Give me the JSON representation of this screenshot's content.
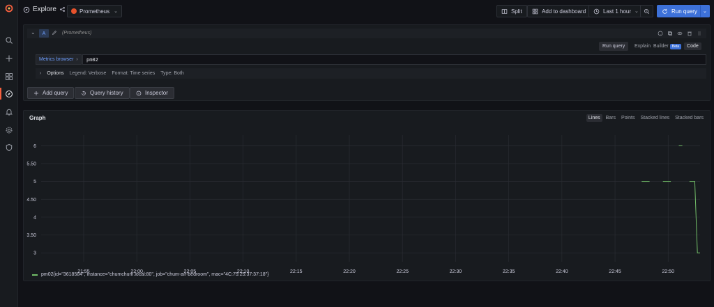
{
  "topbar": {
    "title": "Explore",
    "datasource": "Prometheus",
    "split_label": "Split",
    "add_to_dashboard_label": "Add to dashboard",
    "time_range_label": "Last 1 hour",
    "run_query_label": "Run query"
  },
  "query": {
    "ref_id": "A",
    "datasource_hint": "(Prometheus)",
    "run_query_label": "Run query",
    "mode_explain": "Explain",
    "mode_builder": "Builder",
    "beta_badge": "Beta",
    "mode_code": "Code",
    "metrics_browser_label": "Metrics browser",
    "expression": "pm02",
    "options_title": "Options",
    "legend_info": "Legend: Verbose",
    "format_info": "Format: Time series",
    "type_info": "Type: Both"
  },
  "actions": {
    "add_query": "Add query",
    "query_history": "Query history",
    "inspector": "Inspector"
  },
  "graph": {
    "title": "Graph",
    "modes": [
      "Lines",
      "Bars",
      "Points",
      "Stacked lines",
      "Stacked bars"
    ],
    "active_mode": "Lines"
  },
  "colors": {
    "accent": "#3d71d9",
    "series": "#73bf69",
    "grafana_orange": "#f55f3e"
  },
  "chart_data": {
    "type": "line",
    "title": "",
    "xlabel": "",
    "ylabel": "",
    "x_ticks": [
      "21:55",
      "22:00",
      "22:05",
      "22:10",
      "22:15",
      "22:20",
      "22:25",
      "22:30",
      "22:35",
      "22:40",
      "22:45",
      "22:50"
    ],
    "y_ticks": [
      3,
      3.5,
      4,
      4.5,
      5,
      5.5,
      6
    ],
    "y_tick_labels": [
      "3",
      "3.50",
      "4",
      "4.50",
      "5",
      "5.50",
      "6"
    ],
    "xlim": [
      "21:51",
      "22:53"
    ],
    "ylim": [
      2.75,
      6.3
    ],
    "grid": true,
    "legend_position": "bottom-left",
    "series": [
      {
        "name": "pm02{id=\"3618584\", instance=\"chumchum.local:80\", job=\"chum-air-bedroom\", mac=\"4C:75:25:37:37:18\"}",
        "segments": [
          [
            [
              "22:47:30",
              5
            ],
            [
              "22:48:15",
              5
            ]
          ],
          [
            [
              "22:49:30",
              5
            ],
            [
              "22:50:15",
              5
            ]
          ],
          [
            [
              "22:51:00",
              6
            ],
            [
              "22:51:20",
              6
            ]
          ],
          [
            [
              "22:52:00",
              5
            ],
            [
              "22:52:30",
              5
            ],
            [
              "22:52:45",
              3
            ],
            [
              "22:53:00",
              3
            ]
          ]
        ]
      }
    ]
  }
}
